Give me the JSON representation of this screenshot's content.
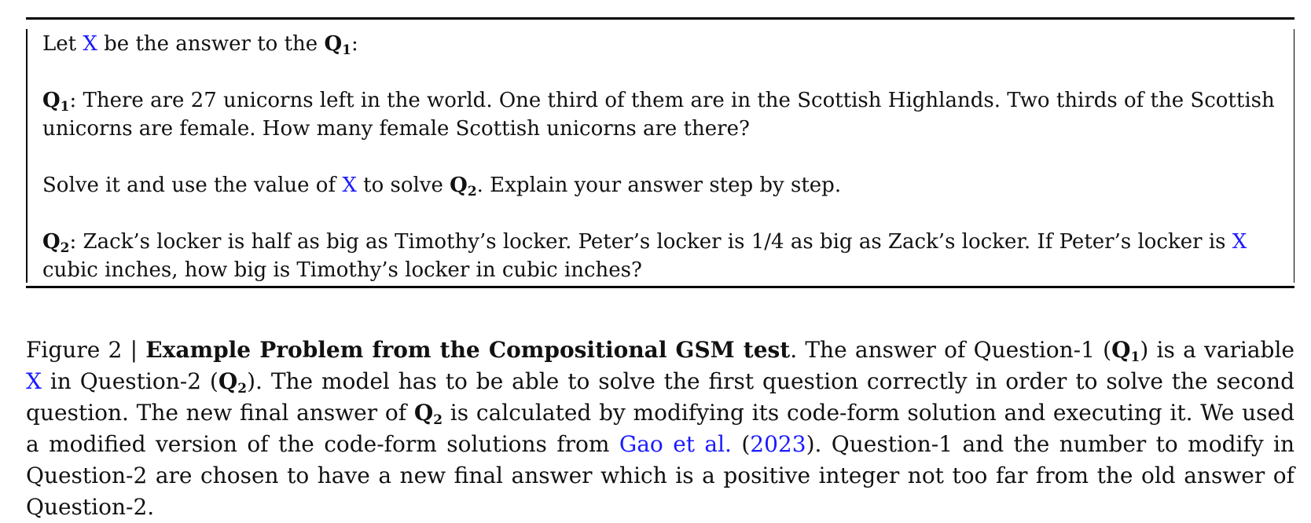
{
  "box": {
    "intro": {
      "pre": "Let ",
      "var": "X",
      "mid": " be the answer to the ",
      "q": "Q",
      "sub": "1",
      "end": ":"
    },
    "q1": {
      "q": "Q",
      "sub": "1",
      "text": ": There are 27 unicorns left in the world. One third of them are in the Scottish Highlands. Two thirds of the Scottish unicorns are female. How many female Scottish unicorns are there?"
    },
    "solve": {
      "pre": "Solve it and use the value of ",
      "var": "X",
      "mid": " to solve ",
      "q": "Q",
      "sub": "2",
      "end": ". Explain your answer step by step."
    },
    "q2": {
      "q": "Q",
      "sub": "2",
      "text1": ": Zack’s locker is half as big as Timothy’s locker. Peter’s locker is 1/4 as big as Zack’s locker. If Peter’s locker is ",
      "var": "X",
      "text2": " cubic inches, how big is Timothy’s locker in cubic inches?"
    }
  },
  "caption": {
    "label": "Figure 2 | ",
    "title": "Example Problem from the Compositional GSM test",
    "t1": ". The answer of Question-1 (",
    "q": "Q",
    "sub1": "1",
    "t2": ") is a variable ",
    "var": "X",
    "t3": " in Question-2 (",
    "sub2": "2",
    "t4": "). The model has to be able to solve the first question correctly in order to solve the second question. The new final answer of ",
    "t5": " is calculated by modifying its code-form solution and executing it. We used a modified version of the code-form solutions from ",
    "cite_author": "Gao et al.",
    "cite_open": " (",
    "cite_year": "2023",
    "t6": "). Question-1 and the number to modify in Question-2 are chosen to have a new final answer which is a positive integer not too far from the old answer of Question-2."
  },
  "colors": {
    "link": "#1a1aff",
    "text": "#111111"
  }
}
